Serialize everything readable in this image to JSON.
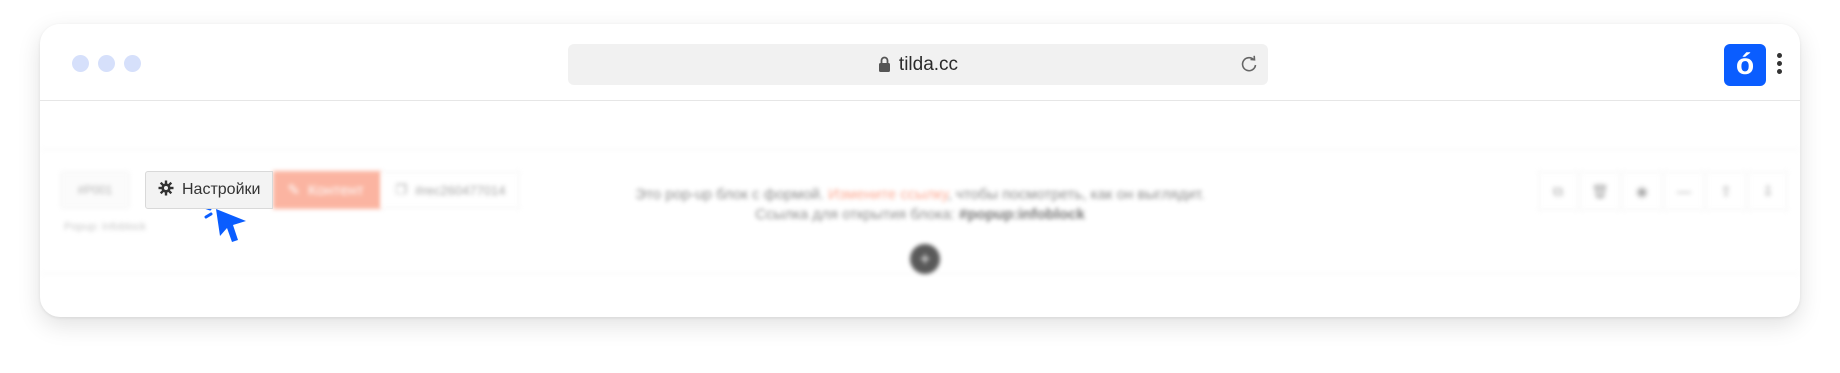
{
  "browser": {
    "url": "tilda.cc",
    "brand_letter": "ó",
    "colors": {
      "accent": "#0a5dff",
      "dots": "#d6e0fb"
    }
  },
  "editor": {
    "block_id": "#P001",
    "block_id_sub": "Popup: Infoblock",
    "settings_label": "Настройки",
    "content_label": "Контент",
    "tag_label": "#rec260477014",
    "center_text": {
      "line1_prefix": "Это pop-up блок с формой.",
      "line1_link": "Измените ссылку",
      "line1_suffix": ", чтобы посмотреть, как он выглядит.",
      "line2_prefix": "Ссылка для открытия блока:",
      "line2_code": "#popup:infoblock"
    },
    "add_symbol": "+",
    "right_tools": [
      "⧉",
      "🗑",
      "◉",
      "—",
      "⇧",
      "⇩"
    ],
    "colors": {
      "content_button": "#fa9c82",
      "link": "#fa8a6c"
    }
  }
}
